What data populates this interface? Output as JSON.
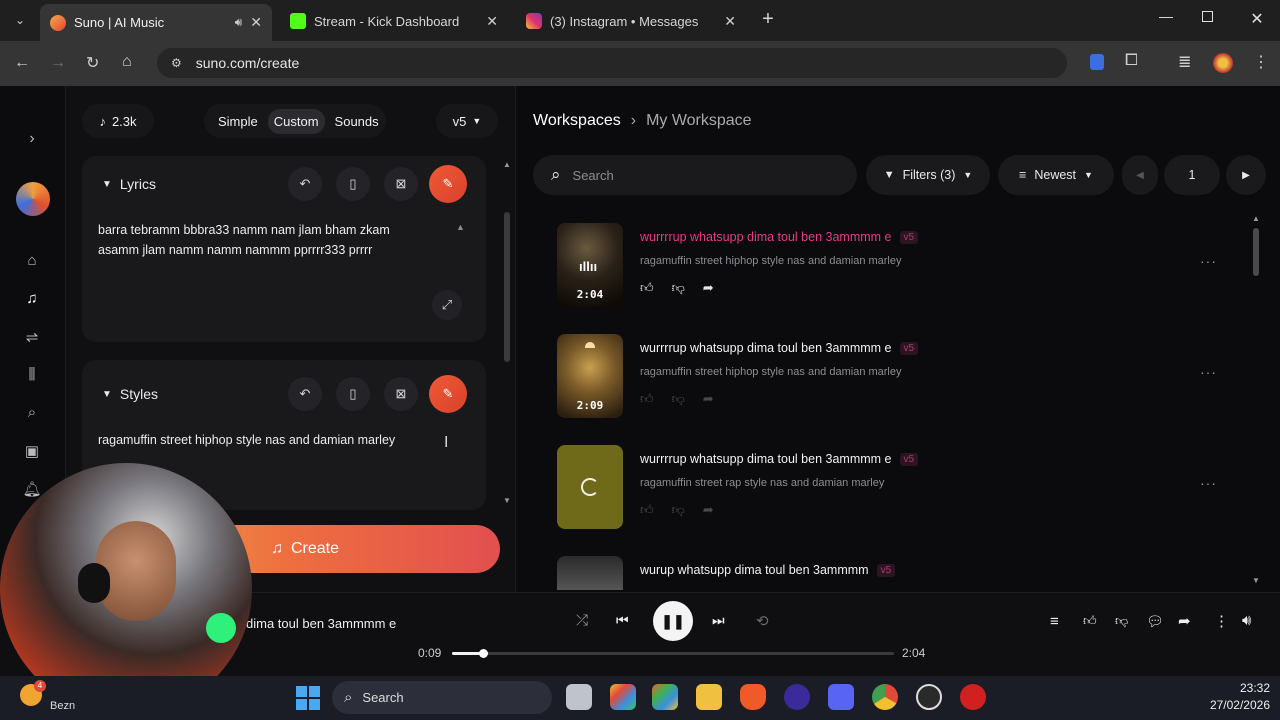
{
  "tabs": [
    {
      "title": "Suno | AI Music",
      "active": true
    },
    {
      "title": "Stream - Kick Dashboard",
      "active": false
    },
    {
      "title": "(3) Instagram • Messages",
      "active": false
    }
  ],
  "address": {
    "url": "suno.com/create"
  },
  "create_panel": {
    "credits": "2.3k",
    "modes": [
      "Simple",
      "Custom",
      "Sounds"
    ],
    "active_mode": "Custom",
    "model": "v5",
    "lyrics": {
      "label": "Lyrics",
      "text_line1": "barra tebramm bbbra33 namm nam jlam bham zkam",
      "text_line2": "asamm jlam namm namm nammm pprrrr333 prrrr"
    },
    "styles": {
      "label": "Styles",
      "text": "ragamuffin street hiphop  style nas and damian marley"
    },
    "create_label": "Create"
  },
  "workspace": {
    "crumb_root": "Workspaces",
    "crumb_current": "My Workspace",
    "search_placeholder": "Search",
    "filters_label": "Filters (3)",
    "sort_label": "Newest",
    "page": "1",
    "songs": [
      {
        "title": "wurrrrup whatsupp dima toul ben 3ammmm e",
        "badge": "v5",
        "style": "ragamuffin street hiphop style nas and damian marley",
        "duration": "2:04",
        "playing": true
      },
      {
        "title": "wurrrrup whatsupp dima toul ben 3ammmm e",
        "badge": "v5",
        "style": "ragamuffin street hiphop style nas and damian marley",
        "duration": "2:09",
        "playing": false
      },
      {
        "title": "wurrrrup whatsupp dima toul ben 3ammmm e",
        "badge": "v5",
        "style": "ragamuffin street rap style nas and damian marley",
        "duration": "",
        "playing": false
      },
      {
        "title": "wurup whatsupp dima toul ben 3ammmm",
        "badge": "v5",
        "style": "",
        "duration": "",
        "playing": false
      }
    ]
  },
  "player": {
    "title": "dima toul ben 3ammmm e",
    "elapsed": "0:09",
    "total": "2:04",
    "progress_fraction": 0.07
  },
  "taskbar": {
    "search_label": "Search",
    "weather": "Bezn",
    "weather_badge": "4",
    "time": "23:32",
    "date": "27/02/2026"
  },
  "colors": {
    "accent": "#e8462f",
    "playing_title": "#e8398a",
    "badge": "#b03a70"
  }
}
